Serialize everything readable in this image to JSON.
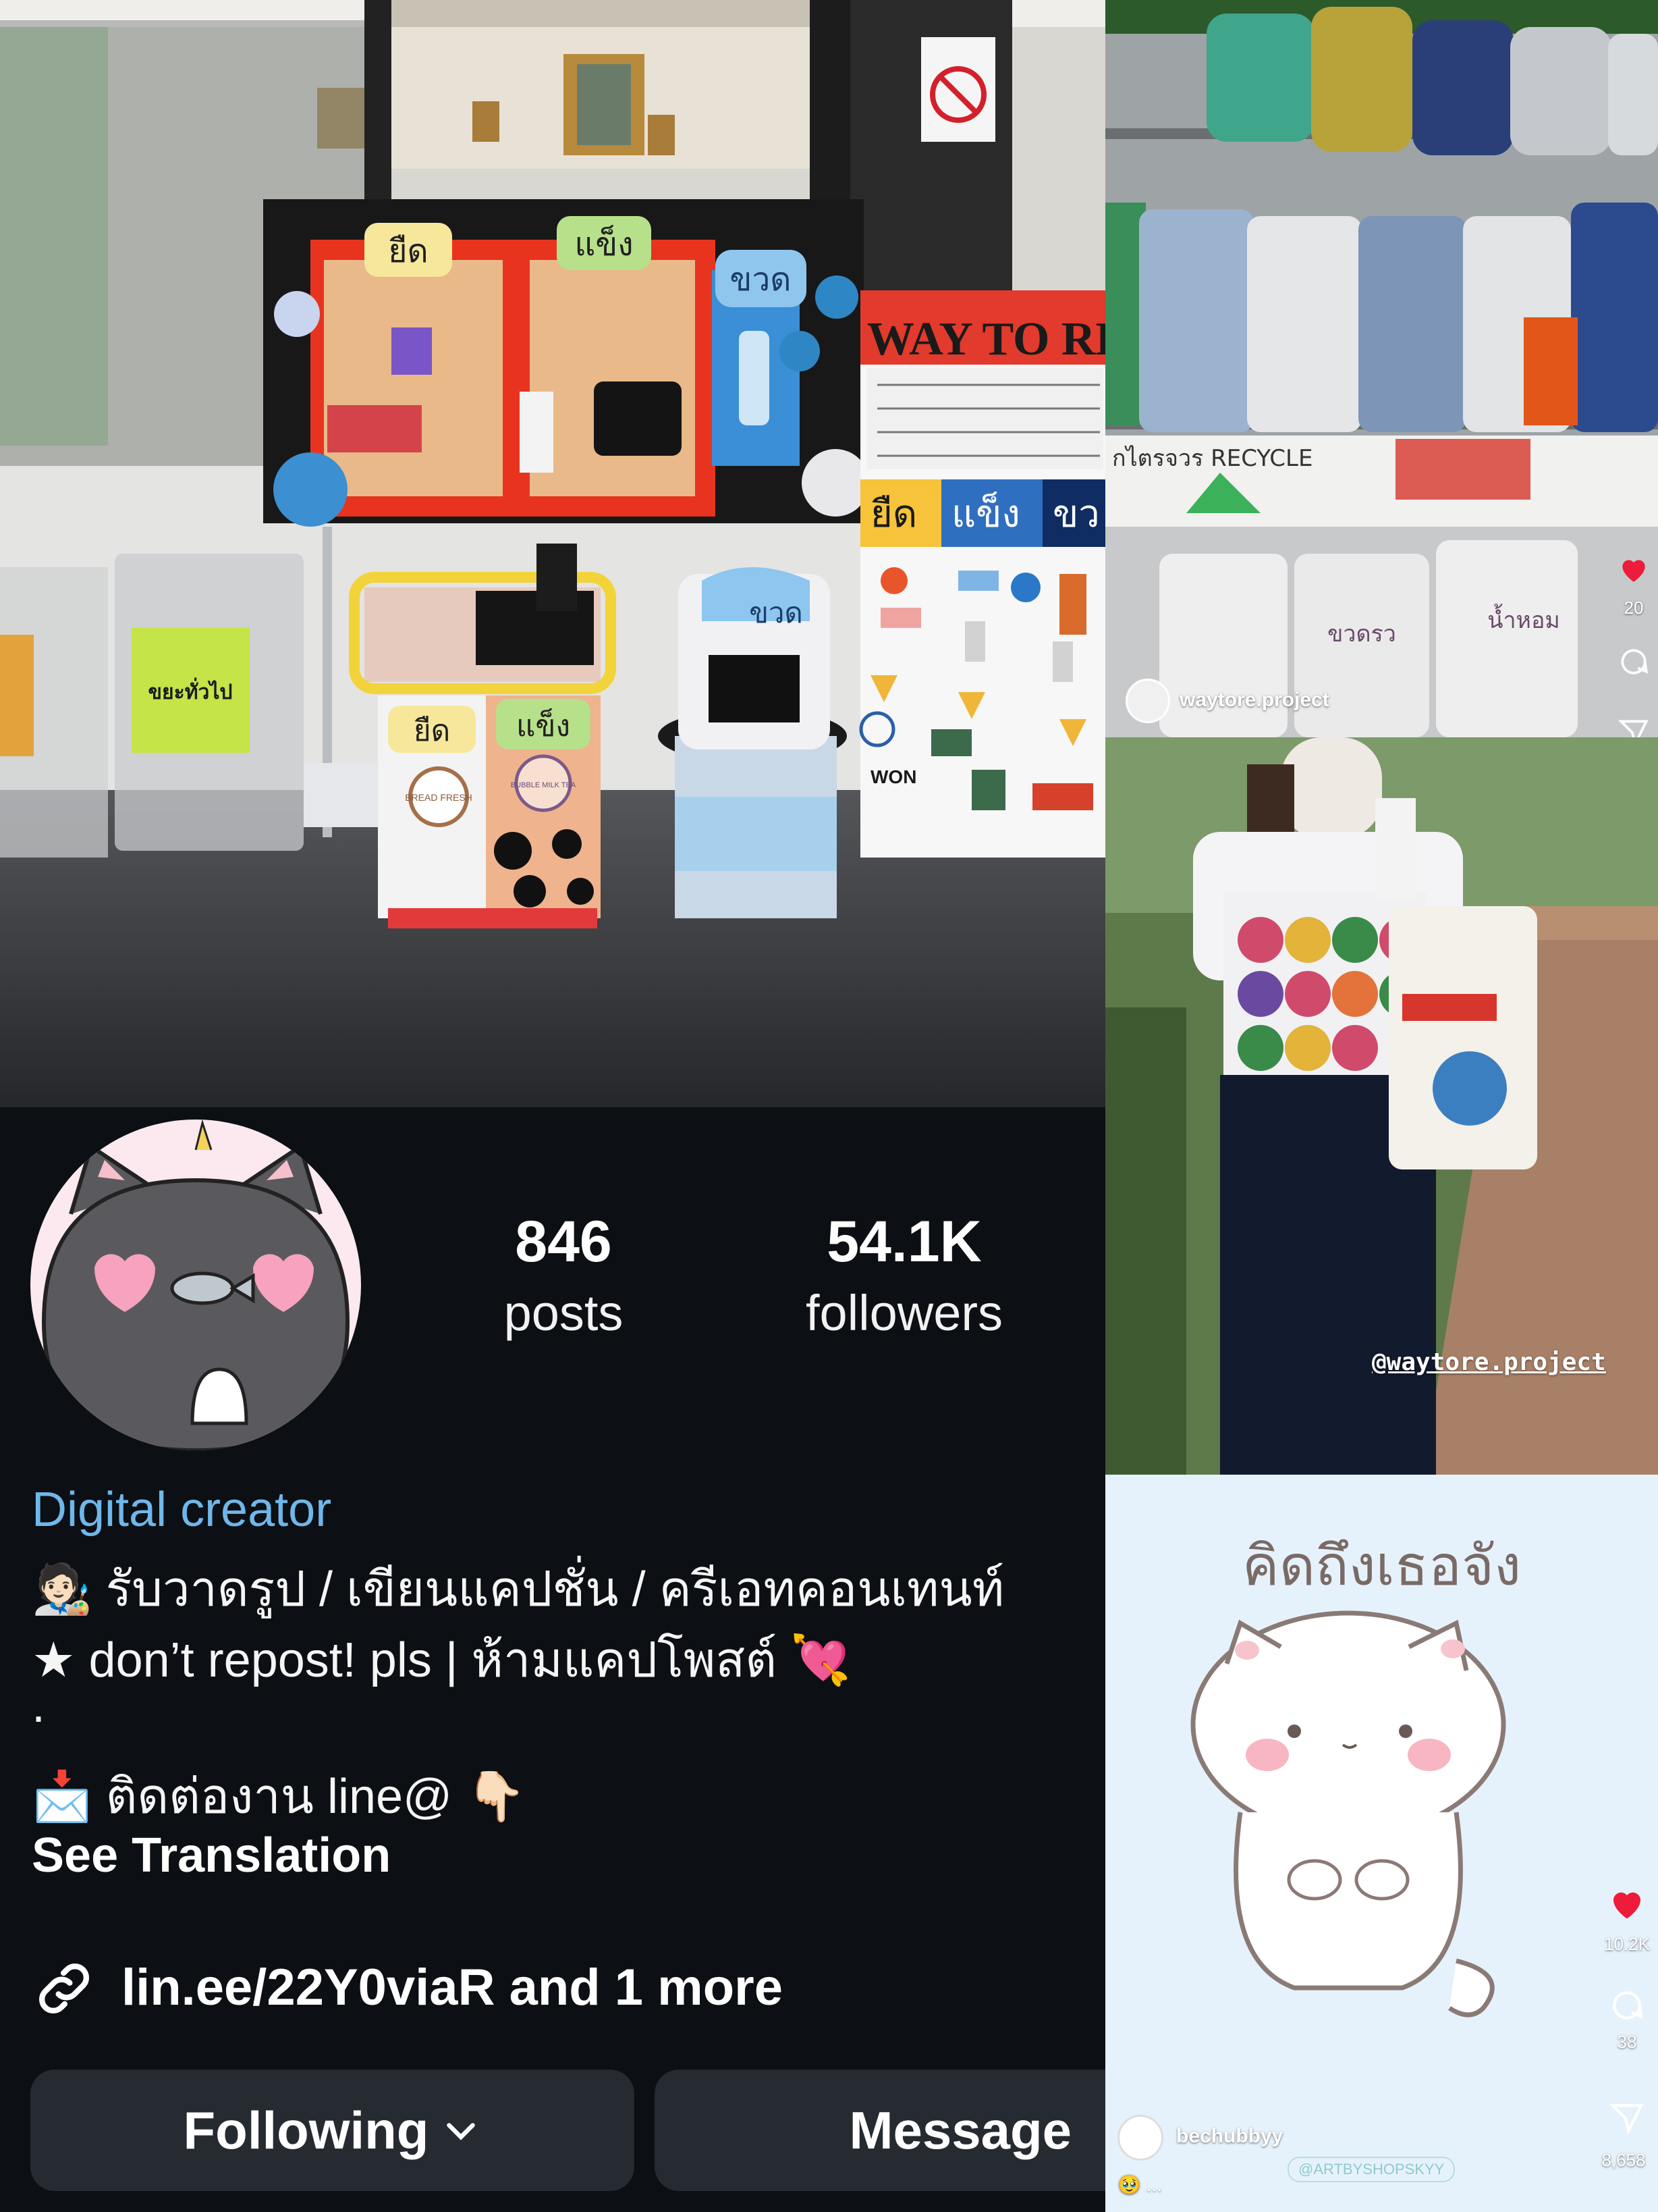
{
  "profile": {
    "stats": {
      "posts_count": "846",
      "posts_label": "posts",
      "followers_count": "54.1K",
      "followers_label": "followers"
    },
    "category": "Digital creator",
    "bio": {
      "line1": "🧑🏻‍🎨 รับวาดรูป / เขียนแคปชั่น / ครีเอทคอนเทนท์",
      "line2": "★ don’t repost! pls | ห้ามแคปโพสต์ 💘",
      "line3": ".",
      "line4": "📩 ติดต่องาน line@ 👇🏻"
    },
    "see_translation": "See Translation",
    "link_text": "lin.ee/22Y0viaR and 1 more",
    "buttons": {
      "following": "Following",
      "message": "Message"
    }
  },
  "photo_main": {
    "board_labels": [
      "ยืด",
      "แข็ง",
      "ขวด"
    ],
    "poster_title": "WAY TO RE",
    "poster_categories": [
      "ยืด",
      "แข็ง",
      "ขว"
    ],
    "bin_sign": "ขยะทั่วไป",
    "bin_labels": [
      "ยืด",
      "แข็ง"
    ],
    "bottle_bin_label": "ขวด",
    "cup_labels": [
      "BREAD FRESH",
      "BUBBLE MILK TEA"
    ],
    "poster_bottom": "WON"
  },
  "reels": [
    {
      "username": "waytore.project",
      "likes": "20",
      "banner_text": "กไตรจวร RECYCLE",
      "bag_labels": [
        "ขวดรว",
        "น้ำหอม"
      ]
    },
    {
      "watermark": "@waytore.project"
    },
    {
      "username": "bechubbyy",
      "caption": "🥹 ...",
      "headline": "คิดถึงเธอจัง",
      "stamp": "@ARTBYSHOPSKYY",
      "likes": "10.2K",
      "comments": "38",
      "shares": "8,658"
    }
  ],
  "colors": {
    "background": "#0c0f14",
    "category_blue": "#6fb7ea",
    "button_bg": "#262a31",
    "like_red": "#ed1c3a"
  }
}
